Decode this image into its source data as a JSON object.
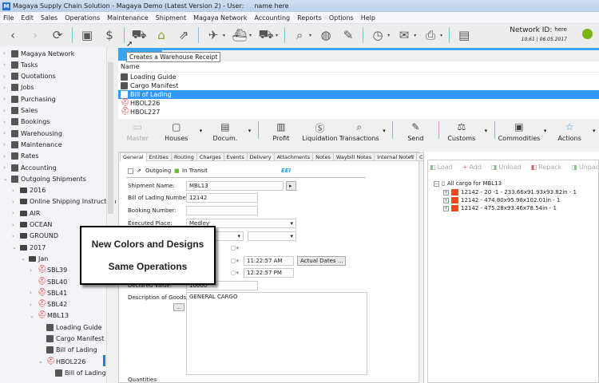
{
  "window": {
    "title": "Magaya Supply Chain Solution - Magaya Demo (Latest Version 2) - User:",
    "user": "name here",
    "logo": "M"
  },
  "menu": [
    "File",
    "Edit",
    "Sales",
    "Operations",
    "Maintenance",
    "Shipment",
    "Magaya Network",
    "Accounting",
    "Reports",
    "Options",
    "Help"
  ],
  "toolbar": {
    "tooltip": "Creates a Warehouse Receipt",
    "network_label": "Network ID:",
    "network_id": "here",
    "version": "10.61 | 06.05.2017",
    "status_color": "#7bb413"
  },
  "sidebar": [
    {
      "label": "Magaya Network",
      "level": 0,
      "icon": "globe-icon",
      "chev": ">"
    },
    {
      "label": "Tasks",
      "level": 0,
      "icon": "clock-icon",
      "chev": ">"
    },
    {
      "label": "Quotations",
      "level": 0,
      "icon": "quote-icon",
      "chev": ">"
    },
    {
      "label": "Jobs",
      "level": 0,
      "icon": "briefcase-icon",
      "chev": ">"
    },
    {
      "label": "Purchasing",
      "level": 0,
      "icon": "purchase-icon",
      "chev": ">"
    },
    {
      "label": "Sales",
      "level": 0,
      "icon": "sales-icon",
      "chev": ">"
    },
    {
      "label": "Bookings",
      "level": 0,
      "icon": "booking-icon",
      "chev": ">"
    },
    {
      "label": "Warehousing",
      "level": 0,
      "icon": "warehouse-icon",
      "chev": ">"
    },
    {
      "label": "Maintenance",
      "level": 0,
      "icon": "wrench-icon",
      "chev": ">"
    },
    {
      "label": "Rates",
      "level": 0,
      "icon": "chart-icon",
      "chev": ">"
    },
    {
      "label": "Accounting",
      "level": 0,
      "icon": "dollar-icon",
      "chev": ">"
    },
    {
      "label": "Outgoing Shipments",
      "level": 0,
      "icon": "outgoing-icon",
      "chev": "v"
    },
    {
      "label": "2016",
      "level": 1,
      "icon": "folder-icon",
      "chev": ">"
    },
    {
      "label": "Online Shipping Instructions",
      "level": 1,
      "icon": "folder-icon",
      "chev": ">"
    },
    {
      "label": "AIR",
      "level": 1,
      "icon": "folder-icon",
      "chev": ">"
    },
    {
      "label": "OCEAN",
      "level": 1,
      "icon": "folder-icon",
      "chev": ">"
    },
    {
      "label": "GROUND",
      "level": 1,
      "icon": "folder-icon",
      "chev": ">"
    },
    {
      "label": "2017",
      "level": 1,
      "icon": "folder-icon",
      "chev": "v"
    },
    {
      "label": "Jan",
      "level": 2,
      "icon": "folder-icon",
      "chev": "v"
    },
    {
      "label": "SBL39",
      "level": 3,
      "icon": "shipment-icon",
      "chev": ">"
    },
    {
      "label": "SBL40",
      "level": 3,
      "icon": "shipment-icon",
      "chev": ""
    },
    {
      "label": "SBL41",
      "level": 3,
      "icon": "shipment-icon",
      "chev": ">"
    },
    {
      "label": "SBL42",
      "level": 3,
      "icon": "shipment-icon",
      "chev": ">"
    },
    {
      "label": "MBL13",
      "level": 3,
      "icon": "shipment-icon",
      "chev": "v"
    },
    {
      "label": "Loading Guide",
      "level": 4,
      "icon": "document-icon",
      "chev": ""
    },
    {
      "label": "Cargo Manifest",
      "level": 4,
      "icon": "document-icon",
      "chev": ""
    },
    {
      "label": "Bill of Lading",
      "level": 4,
      "icon": "document-icon",
      "chev": ""
    },
    {
      "label": "HBOL226",
      "level": 4,
      "icon": "shipment-icon",
      "chev": "v"
    },
    {
      "label": "Bill of Lading",
      "level": 5,
      "icon": "document-icon",
      "chev": ""
    }
  ],
  "list": {
    "header": "Name",
    "items": [
      {
        "label": "Loading Guide",
        "icon": "document-icon",
        "selected": false
      },
      {
        "label": "Cargo Manifest",
        "icon": "document-icon",
        "selected": false
      },
      {
        "label": "Bill of Lading",
        "icon": "document-icon",
        "selected": true
      },
      {
        "label": "HBOL226",
        "icon": "shipment-icon",
        "selected": false
      },
      {
        "label": "HBOL227",
        "icon": "shipment-icon",
        "selected": false
      }
    ]
  },
  "actions": [
    {
      "label": "Master",
      "icon": "master-icon",
      "disabled": true,
      "dropdown": false
    },
    {
      "label": "Houses",
      "icon": "houses-icon",
      "dropdown": true
    },
    {
      "label": "Docum.",
      "icon": "document-icon",
      "dropdown": true,
      "sep": true
    },
    {
      "label": "Profit",
      "icon": "profit-icon"
    },
    {
      "label": "Liquidation",
      "icon": "liquidation-icon"
    },
    {
      "label": "Transactions",
      "icon": "transactions-icon",
      "dropdown": true,
      "sep": true
    },
    {
      "label": "Send",
      "icon": "send-icon",
      "sep": true
    },
    {
      "label": "Customs",
      "icon": "customs-icon",
      "dropdown": true,
      "sep": true
    },
    {
      "label": "Commodities",
      "icon": "commodities-icon",
      "dropdown": true
    },
    {
      "label": "Actions",
      "icon": "actions-icon",
      "dropdown": true,
      "active": true
    }
  ],
  "tabs": [
    "General",
    "Entities",
    "Routing",
    "Charges",
    "Events",
    "Delivery",
    "Attachments",
    "Notes",
    "Waybill Notes",
    "Internal Notes",
    "Comm"
  ],
  "form": {
    "outgoing": "Outgoing",
    "in_transit": "In Transit",
    "eei": "EEI",
    "shipment_name_label": "Shipment Name:",
    "shipment_name": "MBL13",
    "bol_label": "Bill of Lading Number:",
    "bol": "12142",
    "booking_label": "Booking Number:",
    "booking": "",
    "executed_place_label": "Executed Place:",
    "executed_place": "Medley",
    "time1": "11:22:57 AM",
    "actual_dates": "Actual Dates ...",
    "time2": "12:22:57 PM",
    "declared_value_label": "Declared Value:",
    "declared_value": "10000",
    "description_label": "Description of Goods:",
    "description": "GENERAL CARGO",
    "more": "...",
    "quantities_label": "Quantities"
  },
  "cargo": {
    "toolbar": [
      "Load",
      "Add",
      "Unload",
      "Repack",
      "Unpack"
    ],
    "root": "All cargo for MBL13",
    "items": [
      "12142 - 20 -1 - 233.66x91.93x93.82in - 1",
      "12142 - 474.80x95.98x102.01in - 1",
      "12142 - 475.28x93.46x78.54in - 1"
    ]
  },
  "overlay": {
    "line1": "New Colors and Designs",
    "line2": "Same Operations"
  }
}
